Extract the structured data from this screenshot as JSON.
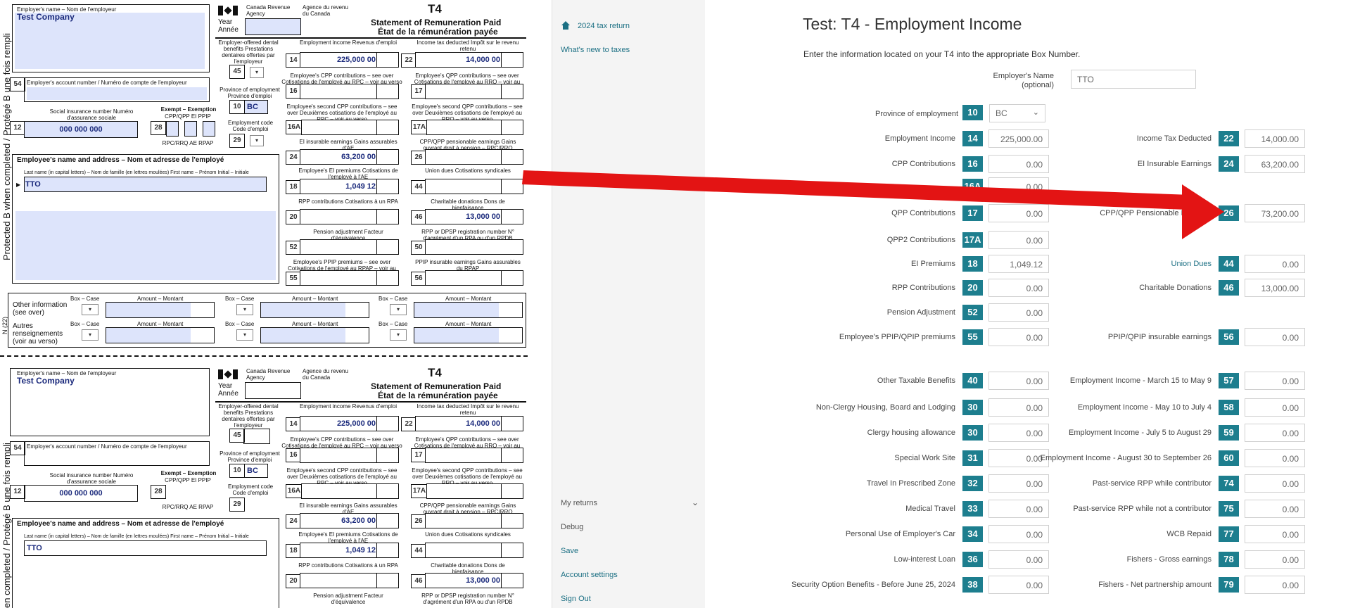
{
  "left": {
    "side_text_1": "Protected B when completed / Protégé B une fois rempli",
    "side_text_2": "N (22)",
    "side_text_3": "en completed / Protégé B une fois rempli",
    "copy": {
      "employer_name_label": "Employer's name – Nom de l'employeur",
      "employer_name": "Test Company",
      "cra_en": "Canada Revenue Agency",
      "cra_fr": "Agence du revenu du Canada",
      "year_label": "Year Année",
      "form_code": "T4",
      "title_en": "Statement of Remuneration Paid",
      "title_fr": "État de la rémunération payée",
      "dental_label": "Employer-offered dental benefits Prestations dentaires offertes par l'employeur",
      "box45": "45",
      "emp_income_label": "Employment income Revenus d'emploi",
      "box14": "14",
      "emp_income_value": "225,000 00",
      "tax_ded_label": "Income tax deducted Impôt sur le revenu retenu",
      "box22": "22",
      "tax_ded_value": "14,000 00",
      "box54": "54",
      "acct_label": "Employer's account number / Numéro de compte de l'employeur",
      "cpp_label": "Employee's CPP contributions – see over Cotisations de l'employé au RPC – voir au verso",
      "box16": "16",
      "qpp_label": "Employee's QPP contributions – see over Cotisations de l'employé au RRQ – voir au verso",
      "box17": "17",
      "prov_label": "Province of employment Province d'emploi",
      "box10": "10",
      "prov_value": "BC",
      "sin_label": "Social insurance number Numéro d'assurance sociale",
      "box12": "12",
      "sin_value": "000 000 000",
      "exempt_label": "Exempt – Exemption",
      "exempt_cols": "CPP/QPP   EI   PPIP",
      "exempt_sub": "RPC/RRQ   AE   RPAP",
      "box28": "28",
      "cpp2_label": "Employee's second CPP contributions – see over Deuxièmes cotisations de l'employé au RPC – voir au verso",
      "box16a": "16A",
      "qpp2_label": "Employee's second QPP contributions – see over Deuxièmes cotisations de l'employé au RRQ – voir au verso",
      "box17a": "17A",
      "empcode_label": "Employment code Code d'emploi",
      "box29": "29",
      "ei_ins_label": "EI insurable earnings Gains assurables d'AE",
      "box24": "24",
      "ei_ins_value": "63,200 00",
      "cppqpp_pens_label": "CPP/QPP pensionable earnings Gains ouvrant droit à pension – RPC/RRQ",
      "box26": "26",
      "employee_label": "Employee's name and address – Nom et adresse de l'employé",
      "name_cols": "Last name (in capital letters) – Nom de famille (en lettres moulées)      First name – Prénom      Initial – Initiale",
      "last_name": "TTO",
      "ei_prem_label": "Employee's EI premiums Cotisations de l'employé à l'AE",
      "box18": "18",
      "ei_prem_value": "1,049 12",
      "union_label": "Union dues Cotisations syndicales",
      "box44": "44",
      "rpp_label": "RPP contributions Cotisations à un RPA",
      "box20": "20",
      "charity_label": "Charitable donations Dons de bienfaisance",
      "box46": "46",
      "charity_value": "13,000 00",
      "pension_adj_label": "Pension adjustment Facteur d'équivalence",
      "box52": "52",
      "rpp_reg_label": "RPP or DPSP registration number N° d'agrément d'un RPA ou d'un RPDB",
      "box50": "50",
      "ppip_label": "Employee's PPIP premiums – see over Cotisations de l'employé au RPAP – voir au verso",
      "box55": "55",
      "ppip_ins_label": "PPIP insurable earnings Gains assurables du RPAP",
      "box56": "56",
      "other_info_label": "Other information (see over)",
      "other_info_fr": "Autres renseignements (voir au verso)",
      "box_case": "Box – Case",
      "amount": "Amount – Montant"
    }
  },
  "sidebar": {
    "tax_return": "2024 tax return",
    "whats_new": "What's new to taxes",
    "my_returns": "My returns",
    "debug": "Debug",
    "save": "Save",
    "account": "Account settings",
    "sign_out": "Sign Out"
  },
  "main": {
    "title": "Test: T4 - Employment Income",
    "subtitle": "Enter the information located on your T4 into the appropriate Box Number.",
    "employer_label": "Employer's Name",
    "employer_optional": "(optional)",
    "employer_value": "TTO",
    "province_label": "Province of employment",
    "province_box": "10",
    "province_value": "BC",
    "left_rows": [
      {
        "label": "Employment Income",
        "box": "14",
        "value": "225,000.00"
      },
      {
        "label": "CPP Contributions",
        "box": "16",
        "value": "0.00"
      },
      {
        "label": "",
        "box": "16A",
        "value": "0.00"
      },
      {
        "label": "QPP Contributions",
        "box": "17",
        "value": "0.00"
      },
      {
        "label": "QPP2 Contributions",
        "box": "17A",
        "value": "0.00"
      },
      {
        "label": "EI Premiums",
        "box": "18",
        "value": "1,049.12"
      },
      {
        "label": "RPP Contributions",
        "box": "20",
        "value": "0.00"
      },
      {
        "label": "Pension Adjustment",
        "box": "52",
        "value": "0.00"
      },
      {
        "label": "Employee's PPIP/QPIP premiums",
        "box": "55",
        "value": "0.00"
      }
    ],
    "right_rows": [
      {
        "label": "Income Tax Deducted",
        "box": "22",
        "value": "14,000.00"
      },
      {
        "label": "EI Insurable Earnings",
        "box": "24",
        "value": "63,200.00"
      },
      {
        "label": "CPP/QPP Pensionable Earnings",
        "box": "26",
        "value": "73,200.00"
      },
      {
        "label": "Union Dues",
        "box": "44",
        "value": "0.00"
      },
      {
        "label": "Charitable Donations",
        "box": "46",
        "value": "13,000.00"
      },
      {
        "label": "PPIP/QPIP insurable earnings",
        "box": "56",
        "value": "0.00"
      }
    ],
    "other_left": [
      {
        "label": "Other Taxable Benefits",
        "box": "40",
        "value": "0.00"
      },
      {
        "label": "Non-Clergy Housing, Board and Lodging",
        "box": "30",
        "value": "0.00"
      },
      {
        "label": "Clergy housing allowance",
        "box": "30",
        "value": "0.00"
      },
      {
        "label": "Special Work Site",
        "box": "31",
        "value": "0.00"
      },
      {
        "label": "Travel In Prescribed Zone",
        "box": "32",
        "value": "0.00"
      },
      {
        "label": "Medical Travel",
        "box": "33",
        "value": "0.00"
      },
      {
        "label": "Personal Use of Employer's Car",
        "box": "34",
        "value": "0.00"
      },
      {
        "label": "Low-interest Loan",
        "box": "36",
        "value": "0.00"
      },
      {
        "label": "Security Option Benefits - Before June 25, 2024",
        "box": "38",
        "value": "0.00"
      }
    ],
    "other_right": [
      {
        "label": "Employment Income - March 15 to May 9",
        "box": "57",
        "value": "0.00"
      },
      {
        "label": "Employment Income - May 10 to July 4",
        "box": "58",
        "value": "0.00"
      },
      {
        "label": "Employment Income - July 5 to August 29",
        "box": "59",
        "value": "0.00"
      },
      {
        "label": "Employment Income - August 30 to September 26",
        "box": "60",
        "value": "0.00"
      },
      {
        "label": "Past-service RPP while contributor",
        "box": "74",
        "value": "0.00"
      },
      {
        "label": "Past-service RPP while not a contributor",
        "box": "75",
        "value": "0.00"
      },
      {
        "label": "WCB Repaid",
        "box": "77",
        "value": "0.00"
      },
      {
        "label": "Fishers - Gross earnings",
        "box": "78",
        "value": "0.00"
      },
      {
        "label": "Fishers - Net partnership amount",
        "box": "79",
        "value": "0.00"
      }
    ],
    "accent_color": "#1d7e8e",
    "arrow_color": "#e31414"
  }
}
